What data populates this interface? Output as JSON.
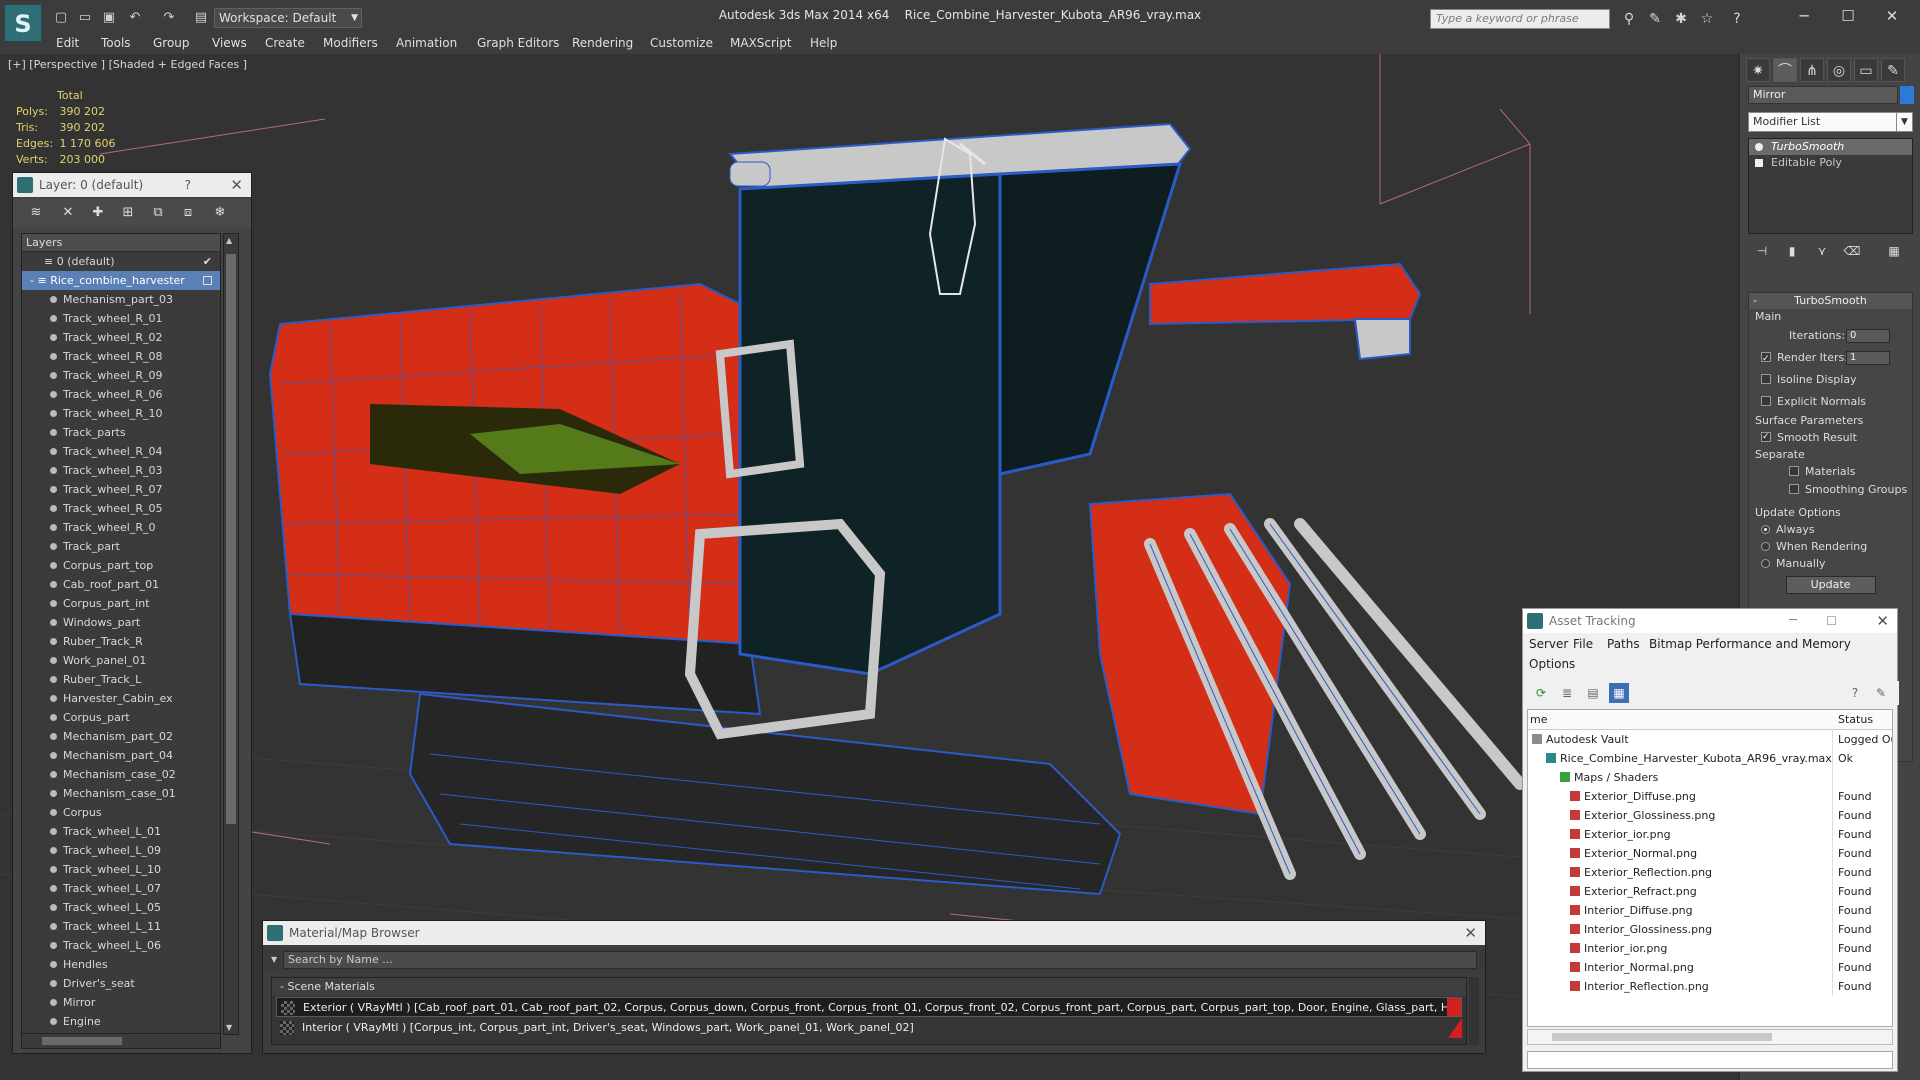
{
  "window": {
    "app_title": "Autodesk 3ds Max  2014 x64",
    "file_title": "Rice_Combine_Harvester_Kubota_AR96_vray.max",
    "workspace": "Workspace: Default",
    "search_placeholder": "Type a keyword or phrase"
  },
  "menu": [
    "Edit",
    "Tools",
    "Group",
    "Views",
    "Create",
    "Modifiers",
    "Animation",
    "Graph Editors",
    "Rendering",
    "Customize",
    "MAXScript",
    "Help"
  ],
  "viewport": {
    "label": "[+] [Perspective ] [Shaded + Edged Faces ]",
    "stats": {
      "header": "Total",
      "rows": [
        {
          "label": "Polys:",
          "value": "390 202"
        },
        {
          "label": "Tris:",
          "value": "390 202"
        },
        {
          "label": "Edges:",
          "value": "1 170 606"
        },
        {
          "label": "Verts:",
          "value": "203 000"
        }
      ]
    }
  },
  "layer_panel": {
    "title": "Layer: 0 (default)",
    "help": "?",
    "list_header": "Layers",
    "default_layer": "0 (default)",
    "selected_layer": "Rice_combine_harvester",
    "objects": [
      "Mechanism_part_03",
      "Track_wheel_R_01",
      "Track_wheel_R_02",
      "Track_wheel_R_08",
      "Track_wheel_R_09",
      "Track_wheel_R_06",
      "Track_wheel_R_10",
      "Track_parts",
      "Track_wheel_R_04",
      "Track_wheel_R_03",
      "Track_wheel_R_07",
      "Track_wheel_R_05",
      "Track_wheel_R_0",
      "Track_part",
      "Corpus_part_top",
      "Cab_roof_part_01",
      "Corpus_part_int",
      "Windows_part",
      "Ruber_Track_R",
      "Work_panel_01",
      "Ruber_Track_L",
      "Harvester_Cabin_ex",
      "Corpus_part",
      "Mechanism_part_02",
      "Mechanism_part_04",
      "Mechanism_case_02",
      "Mechanism_case_01",
      "Corpus",
      "Track_wheel_L_01",
      "Track_wheel_L_09",
      "Track_wheel_L_10",
      "Track_wheel_L_07",
      "Track_wheel_L_05",
      "Track_wheel_L_11",
      "Track_wheel_L_06",
      "Hendles",
      "Driver's_seat",
      "Mirror",
      "Engine"
    ]
  },
  "command_panel": {
    "object_name": "Mirror",
    "object_color": "#2a7ad6",
    "modifier_list": "Modifier List",
    "stack": [
      "TurboSmooth",
      "Editable Poly"
    ],
    "rollout_title": "TurboSmooth",
    "main_label": "Main",
    "iterations_label": "Iterations:",
    "iterations_value": "0",
    "render_iters_label": "Render Iters:",
    "render_iters_value": "1",
    "isoline": "Isoline Display",
    "explicit_normals": "Explicit Normals",
    "surface_label": "Surface Parameters",
    "smooth_result": "Smooth Result",
    "separate_label": "Separate",
    "materials": "Materials",
    "smoothing_groups": "Smoothing Groups",
    "update_options": "Update Options",
    "always": "Always",
    "when_rendering": "When Rendering",
    "manually": "Manually",
    "update_button": "Update"
  },
  "asset_tracking": {
    "title": "Asset Tracking",
    "menu": [
      "Server",
      "File",
      "Paths",
      "Bitmap Performance and Memory",
      "Options"
    ],
    "col_name": "me",
    "col_status": "Status",
    "rows": [
      {
        "name": "Autodesk Vault",
        "status": "Logged Ou"
      },
      {
        "name": "Rice_Combine_Harvester_Kubota_AR96_vray.max",
        "status": "Ok"
      },
      {
        "name": "Maps / Shaders",
        "status": ""
      },
      {
        "name": "Exterior_Diffuse.png",
        "status": "Found"
      },
      {
        "name": "Exterior_Glossiness.png",
        "status": "Found"
      },
      {
        "name": "Exterior_ior.png",
        "status": "Found"
      },
      {
        "name": "Exterior_Normal.png",
        "status": "Found"
      },
      {
        "name": "Exterior_Reflection.png",
        "status": "Found"
      },
      {
        "name": "Exterior_Refract.png",
        "status": "Found"
      },
      {
        "name": "Interior_Diffuse.png",
        "status": "Found"
      },
      {
        "name": "Interior_Glossiness.png",
        "status": "Found"
      },
      {
        "name": "Interior_ior.png",
        "status": "Found"
      },
      {
        "name": "Interior_Normal.png",
        "status": "Found"
      },
      {
        "name": "Interior_Reflection.png",
        "status": "Found"
      }
    ]
  },
  "material_browser": {
    "title": "Material/Map Browser",
    "search_placeholder": "Search by Name ...",
    "group": "- Scene Materials",
    "rows": [
      "Exterior ( VRayMtl ) [Cab_roof_part_01, Cab_roof_part_02, Corpus, Corpus_down, Corpus_front, Corpus_front_01, Corpus_front_02, Corpus_front_part, Corpus_part, Corpus_part_top, Door, Engine, Glass_part, Harvester_Cabin_...",
      "Interior ( VRayMtl ) [Corpus_int, Corpus_part_int, Driver's_seat, Windows_part, Work_panel_01, Work_panel_02]"
    ]
  }
}
